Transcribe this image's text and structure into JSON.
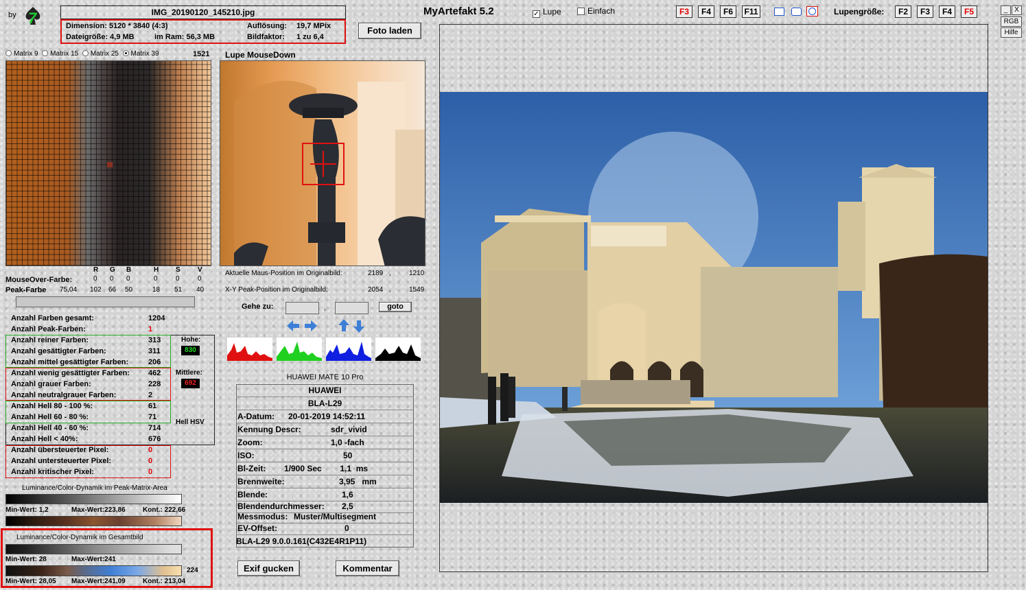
{
  "app": {
    "title": "MyArtefakt 5.2",
    "by_label": "by",
    "logo_text": "7"
  },
  "file": {
    "name": "IMG_20190120_145210.jpg",
    "dimension": "Dimension: 5120 * 3840 (4:3)",
    "aufloesung_label": "Auflösung:",
    "aufloesung_value": "19,7 MPix",
    "dateigroesse": "Dateigröße: 4,9 MB",
    "im_ram": "im Ram: 56,3 MB",
    "bildfaktor_label": "Bildfaktor:",
    "bildfaktor_value": "1 zu 6,4"
  },
  "toolbar": {
    "foto_laden": "Foto laden",
    "lupe_label": "Lupe",
    "lupe_checked": true,
    "einfach_label": "Einfach",
    "einfach_checked": false,
    "fkeys_left": [
      "F3",
      "F4",
      "F6",
      "F11"
    ],
    "lupengroesse_label": "Lupengröße:",
    "fkeys_right": [
      "F2",
      "F3",
      "F4",
      "F5"
    ],
    "active_fkey_color": "#e00000"
  },
  "window_controls": {
    "minimize": "_",
    "close": "X",
    "rgb": "RGB",
    "hilfe": "Hilfe"
  },
  "matrix": {
    "options": [
      "Matrix 9",
      "Matrix 15",
      "Matrix 25",
      "Matrix 39"
    ],
    "selected": "Matrix 39",
    "count": "1521"
  },
  "lupe": {
    "title": "Lupe MouseDown",
    "aktuelle_label": "Aktuelle Maus-Position  im Originalbild:",
    "aktuelle_x": "2189",
    "aktuelle_y": "1210",
    "peak_label": "X-Y Peak-Position  im Originalbild:",
    "peak_x": "2054",
    "peak_y": "1549",
    "gehe_zu": "Gehe zu:",
    "goto": "goto",
    "sep": ","
  },
  "color_table": {
    "headers": [
      "R",
      "G",
      "B",
      "H",
      "S",
      "V"
    ],
    "mouseover_label": "MouseOver-Farbe:",
    "mouseover_values": [
      "0",
      "0",
      "0",
      "0",
      "0",
      "0"
    ],
    "peak_label": "Peak-Farbe",
    "peak_extra": "75,04",
    "peak_values": [
      "102",
      "66",
      "50",
      "18",
      "51",
      "40"
    ]
  },
  "stats": {
    "farben_gesamt_label": "Anzahl Farben gesamt:",
    "farben_gesamt": "1204",
    "peak_farben_label": "Anzahl Peak-Farben:",
    "peak_farben": "1",
    "reiner_label": "Anzahl reiner Farben:",
    "reiner": "313",
    "gesaettigter_label": "Anzahl gesättigter Farben:",
    "gesaettigter": "311",
    "mittel_label": "Anzahl mittel gesättigter Farben:",
    "mittel": "206",
    "wenig_label": "Anzahl wenig gesättigter Farben:",
    "wenig": "462",
    "grauer_label": "Anzahl grauer Farben:",
    "grauer": "228",
    "neutral_label": "Anzahl neutralgrauer Farben:",
    "neutral": "2",
    "hell80_label": "Anzahl Hell 80 - 100 %:",
    "hell80": "61",
    "hell60_label": "Anzahl Hell 60 - 80 %:",
    "hell60": "71",
    "hell40_label": "Anzahl Hell 40 - 60 %:",
    "hell40": "714",
    "hell_lt40_label": "Anzahl Hell < 40%:",
    "hell_lt40": "676",
    "ueber_label": "Anzahl übersteuerter Pixel:",
    "ueber": "0",
    "unter_label": "Anzahl untersteuerter Pixel:",
    "unter": "0",
    "kritisch_label": "Anzahl kritischer Pixel:",
    "kritisch": "0",
    "hohe_label": "Hohe:",
    "hohe_value": "830",
    "mittlere_label": "Mittlere:",
    "mittlere_value": "692",
    "hell_hsv_label": "Hell HSV"
  },
  "dynamics_peak": {
    "title": "Luminance/Color-Dynamik im Peak-Matrix-Area",
    "min": "Min-Wert: 1,2",
    "max": "Max-Wert:223,86",
    "kont": "Kont.: 222,66"
  },
  "dynamics_total": {
    "title": "Luminance/Color-Dynamik im Gesamtbild",
    "min1": "Min-Wert: 28",
    "max1": "Max-Wert:241",
    "side_value": "224",
    "min2": "Min-Wert: 28,05",
    "max2": "Max-Wert:241,09",
    "kont2": "Kont.: 213,04"
  },
  "exif": {
    "camera_title": "HUAWEI MATE 10 Pro",
    "make": "HUAWEI",
    "model": "BLA-L29",
    "rows": [
      {
        "label": "A-Datum:",
        "value": "20-01-2019  14:52:11"
      },
      {
        "label": "Kennung Descr:",
        "value": "sdr_vivid"
      },
      {
        "label": "Zoom:",
        "value": "1,0  -fach"
      },
      {
        "label": "ISO:",
        "value": "50"
      },
      {
        "label": "Bl-Zeit:",
        "value": "1/900 Sec        1,1  ms"
      },
      {
        "label": "Brennweite:",
        "value": "3,95   mm"
      },
      {
        "label": "Blende:",
        "value": "1,6"
      },
      {
        "label": "Blendendurchmesser:",
        "value": "2,5"
      },
      {
        "label": "Messmodus:",
        "value": "Muster/Multisegment"
      },
      {
        "label": "EV-Offset:",
        "value": "0"
      }
    ],
    "firmware": "BLA-L29 9.0.0.161(C432E4R1P11)",
    "exif_button": "Exif gucken",
    "kommentar_button": "Kommentar"
  }
}
